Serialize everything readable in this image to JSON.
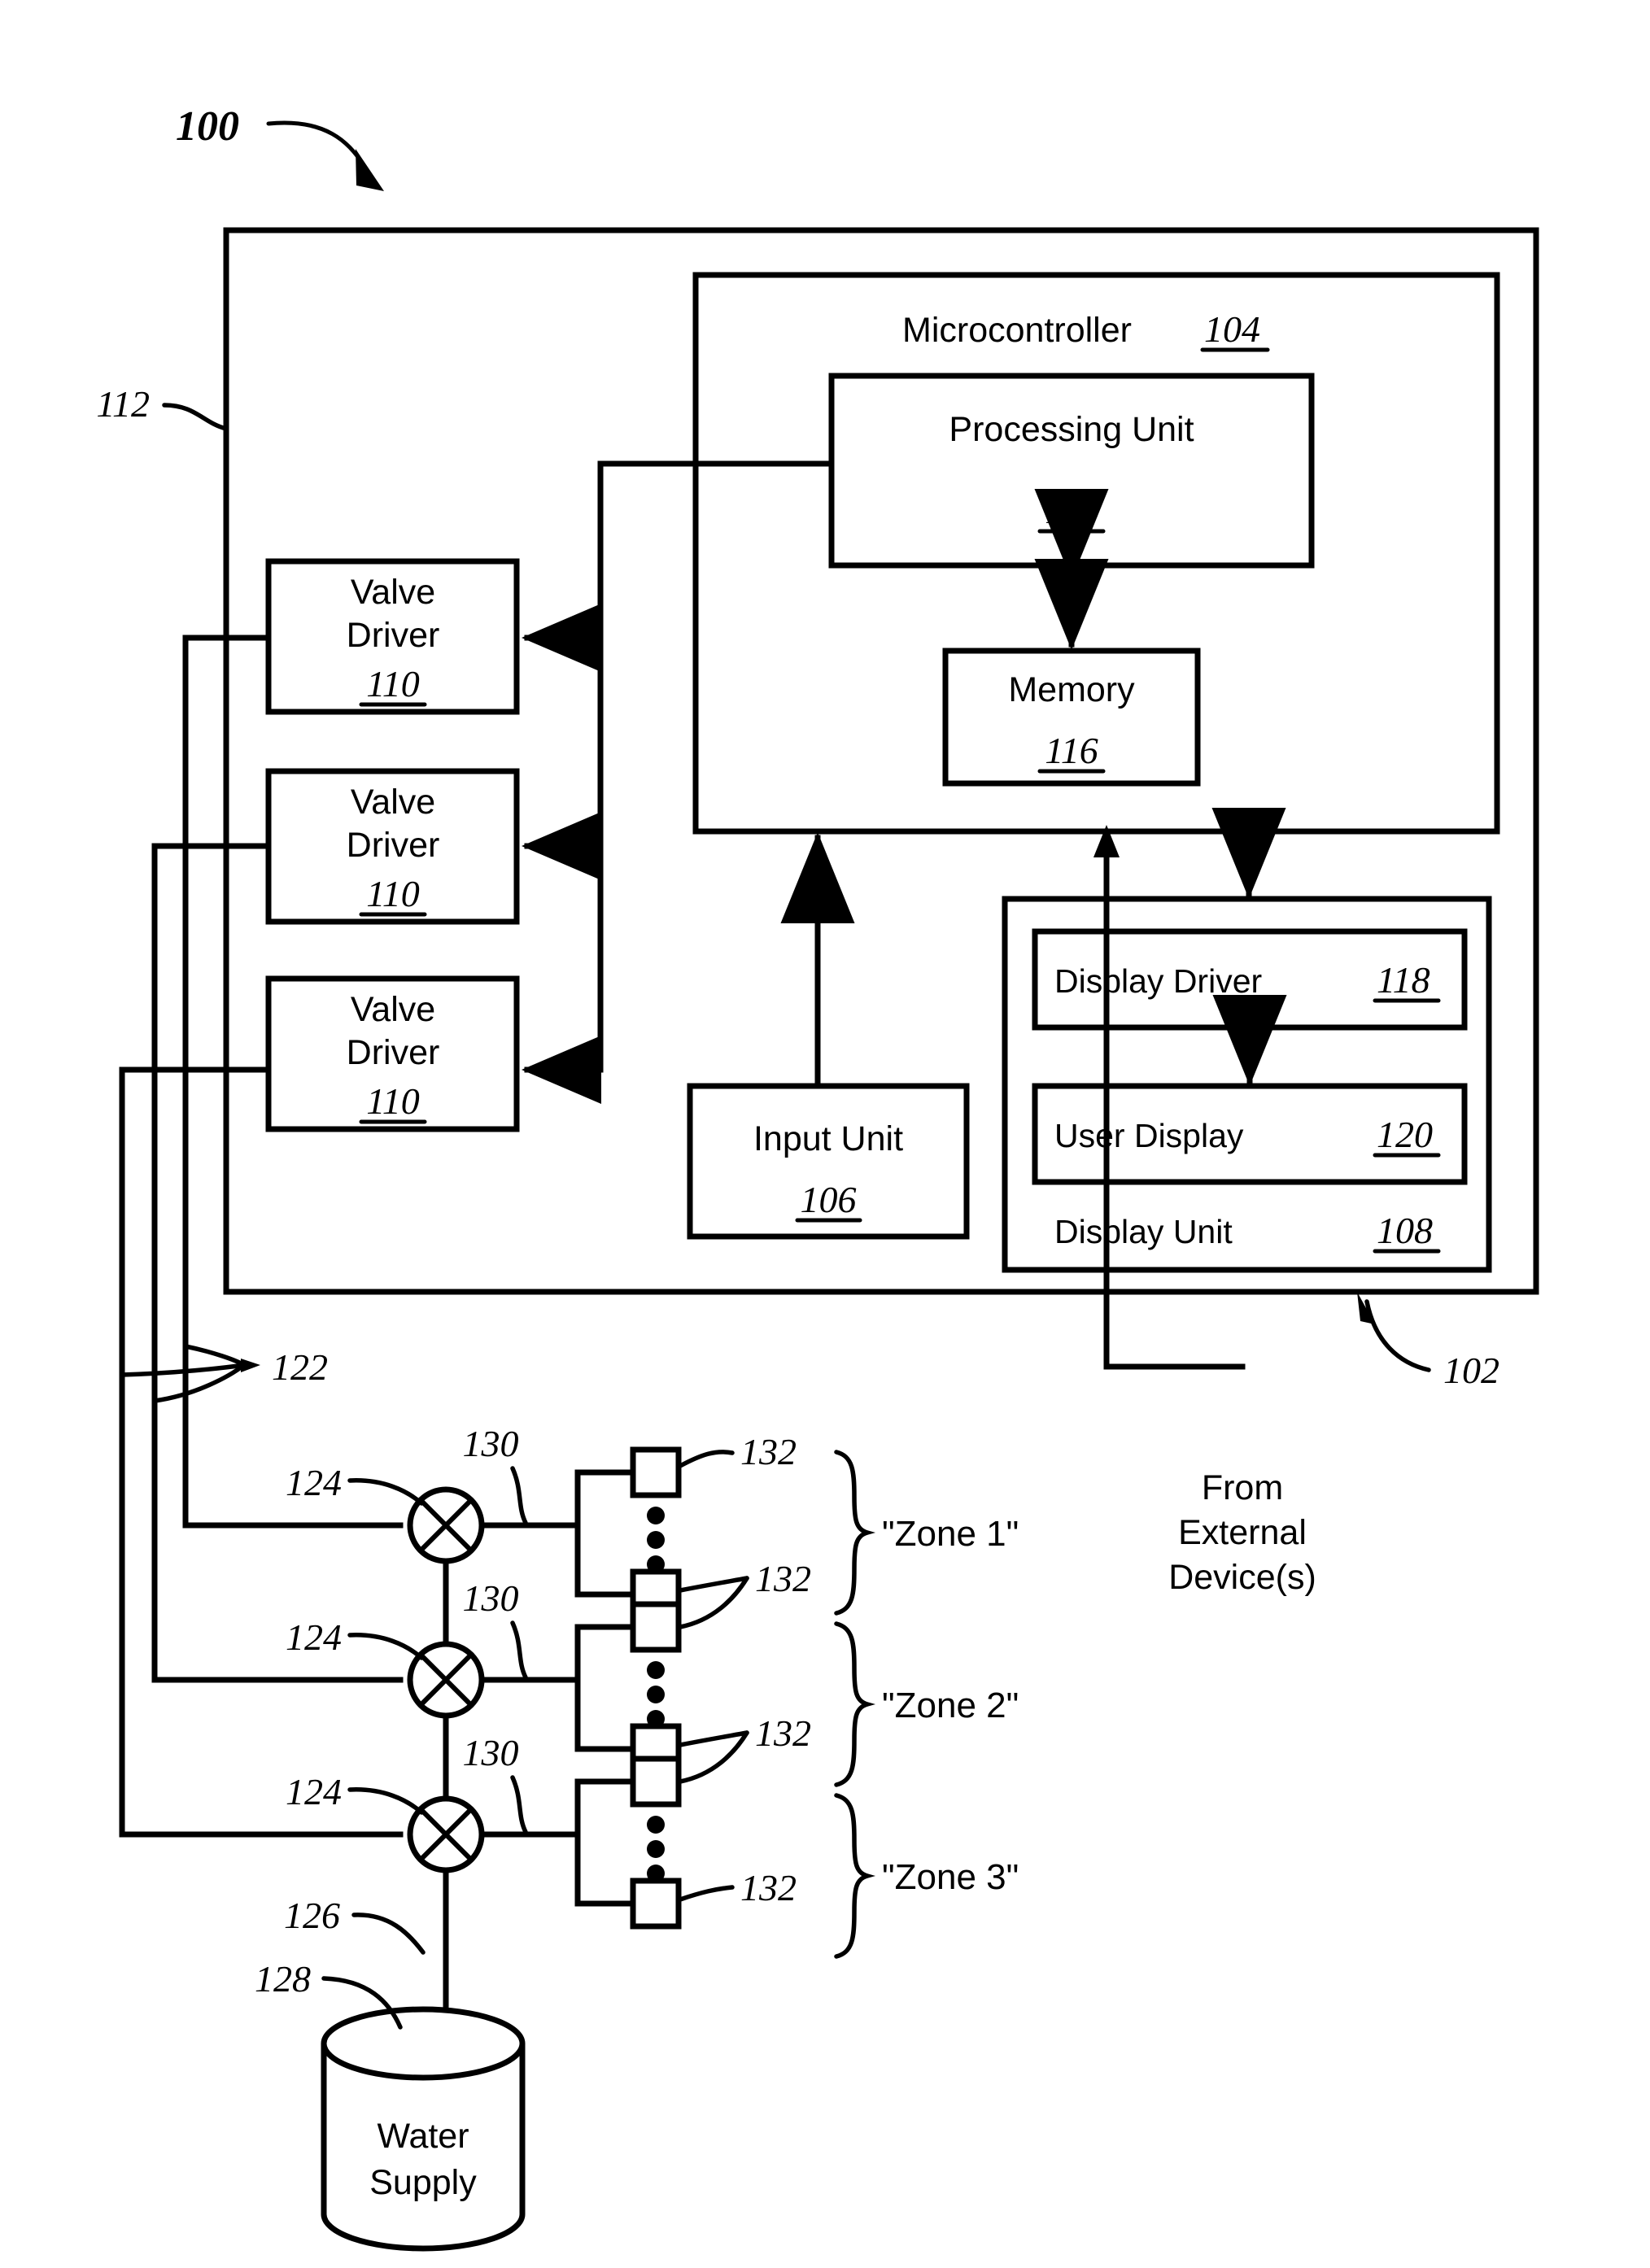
{
  "figure": {
    "ref_100": "100",
    "ref_102": "102",
    "ref_112": "112",
    "ref_122": "122",
    "ref_126": "126",
    "ref_128": "128"
  },
  "controller": {
    "microcontroller_label": "Microcontroller",
    "microcontroller_ref": "104",
    "processing_unit_label": "Processing Unit",
    "processing_unit_ref": "114",
    "memory_label": "Memory",
    "memory_ref": "116"
  },
  "input_unit": {
    "label": "Input Unit",
    "ref": "106"
  },
  "display_unit": {
    "label": "Display Unit",
    "ref": "108",
    "display_driver_label": "Display Driver",
    "display_driver_ref": "118",
    "user_display_label": "User Display",
    "user_display_ref": "120"
  },
  "valve_drivers": [
    {
      "line1": "Valve",
      "line2": "Driver",
      "ref": "110"
    },
    {
      "line1": "Valve",
      "line2": "Driver",
      "ref": "110"
    },
    {
      "line1": "Valve",
      "line2": "Driver",
      "ref": "110"
    }
  ],
  "valves": [
    {
      "ref": "124"
    },
    {
      "ref": "124"
    },
    {
      "ref": "124"
    }
  ],
  "laterals": [
    {
      "ref": "130"
    },
    {
      "ref": "130"
    },
    {
      "ref": "130"
    }
  ],
  "sprinkler_refs": [
    {
      "ref": "132"
    },
    {
      "ref": "132"
    },
    {
      "ref": "132"
    },
    {
      "ref": "132"
    }
  ],
  "zones": [
    {
      "label": "\"Zone 1\""
    },
    {
      "label": "\"Zone 2\""
    },
    {
      "label": "\"Zone 3\""
    }
  ],
  "water_supply": {
    "line1": "Water",
    "line2": "Supply"
  },
  "external": {
    "line1": "From",
    "line2": "External",
    "line3": "Device(s)"
  },
  "colors": {
    "stroke": "#000000",
    "background": "#ffffff"
  }
}
